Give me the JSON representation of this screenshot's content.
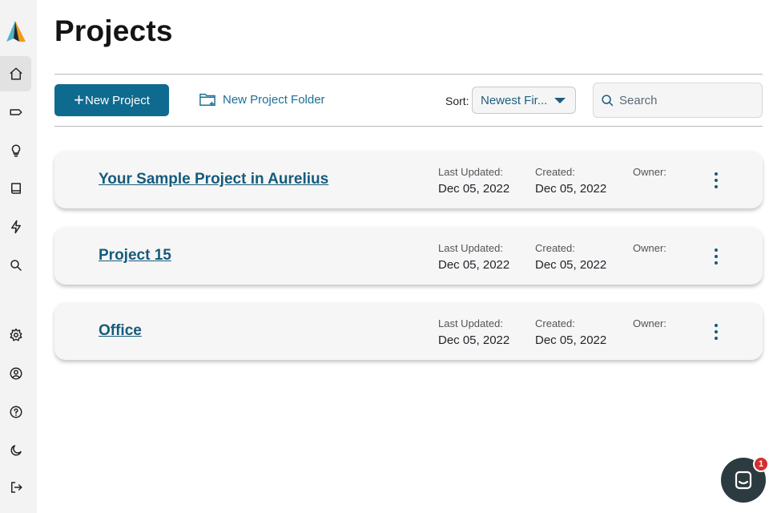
{
  "page": {
    "title": "Projects"
  },
  "sidebar": {
    "items": [
      {
        "name": "home",
        "icon": "home-icon",
        "active": true
      },
      {
        "name": "tags",
        "icon": "tag-icon"
      },
      {
        "name": "insights",
        "icon": "lightbulb-icon"
      },
      {
        "name": "library",
        "icon": "book-icon"
      },
      {
        "name": "activity",
        "icon": "lightning-icon"
      },
      {
        "name": "search",
        "icon": "search-icon"
      },
      {
        "name": "settings",
        "icon": "gear-icon"
      },
      {
        "name": "account",
        "icon": "user-circle-icon"
      },
      {
        "name": "help",
        "icon": "help-circle-icon"
      },
      {
        "name": "dark-mode",
        "icon": "moon-icon"
      },
      {
        "name": "logout",
        "icon": "logout-icon"
      }
    ]
  },
  "toolbar": {
    "new_project_plus": "+",
    "new_project_label": "New Project",
    "new_folder_label": "New Project Folder",
    "sort_label": "Sort:",
    "sort_value": "Newest Fir...",
    "search_placeholder": "Search"
  },
  "projects": [
    {
      "title": "Your Sample Project in Aurelius",
      "last_updated_label": "Last Updated:",
      "last_updated": "Dec 05, 2022",
      "created_label": "Created:",
      "created": "Dec 05, 2022",
      "owner_label": "Owner:",
      "owner": ""
    },
    {
      "title": "Project 15",
      "last_updated_label": "Last Updated:",
      "last_updated": "Dec 05, 2022",
      "created_label": "Created:",
      "created": "Dec 05, 2022",
      "owner_label": "Owner:",
      "owner": ""
    },
    {
      "title": "Office",
      "last_updated_label": "Last Updated:",
      "last_updated": "Dec 05, 2022",
      "created_label": "Created:",
      "created": "Dec 05, 2022",
      "owner_label": "Owner:",
      "owner": ""
    }
  ],
  "chat": {
    "badge_count": "1"
  },
  "colors": {
    "accent": "#0f6a8f",
    "link": "#155b7c",
    "badge": "#d32f2f"
  }
}
